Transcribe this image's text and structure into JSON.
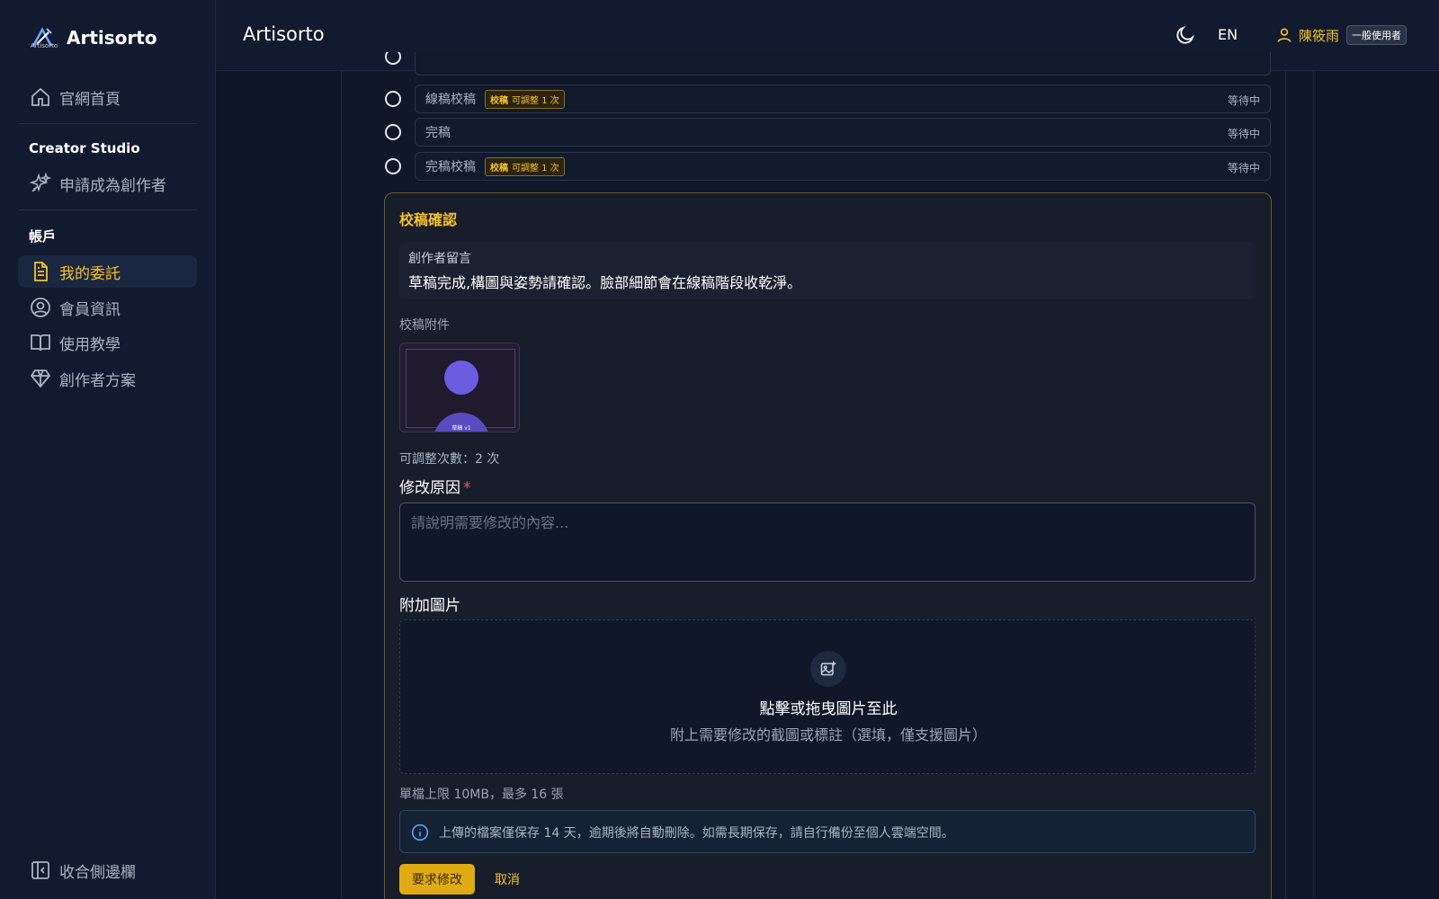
{
  "brand": {
    "name": "Artisorto",
    "sub": "Artisorto"
  },
  "sidebar": {
    "home": "官網首頁",
    "creator_section": "Creator Studio",
    "apply_creator": "申請成為創作者",
    "account_section": "帳戶",
    "items": [
      "我的委託",
      "會員資訊",
      "使用教學",
      "創作者方案"
    ],
    "collapse": "收合側邊欄"
  },
  "header": {
    "title": "Artisorto",
    "lang": "EN",
    "user_name": "陳筱雨",
    "user_role": "一般使用者"
  },
  "steps": [
    {
      "name": "線稿校稿",
      "tag_label": "校稿",
      "tag_text": "可調整 1 次",
      "status": "等待中"
    },
    {
      "name": "完稿",
      "status": "等待中"
    },
    {
      "name": "完稿校稿",
      "tag_label": "校稿",
      "tag_text": "可調整 1 次",
      "status": "等待中"
    }
  ],
  "panel": {
    "title": "校稿確認",
    "message_label": "創作者留言",
    "message_text": "草稿完成,構圖與姿勢請確認。臉部細節會在線稿階段收乾淨。",
    "attachment_label": "校稿附件",
    "thumb_caption": "草稿 v1",
    "adjust_count": "可調整次數：2 次",
    "reason_label": "修改原因",
    "required_mark": "*",
    "reason_placeholder": "請說明需要修改的內容...",
    "image_label": "附加圖片",
    "dropzone_title": "點擊或拖曳圖片至此",
    "dropzone_sub": "附上需要修改的截圖或標註（選填，僅支援圖片）",
    "limit_text": "單檔上限 10MB，最多 16 張",
    "notice_text": "上傳的檔案僅保存 14 天，逾期後將自動刪除。如需長期保存，請自行備份至個人雲端空間。",
    "submit_label": "要求修改",
    "cancel_label": "取消"
  },
  "colors": {
    "accent": "#f4c22b",
    "bg": "#0d1526",
    "panel_border": "#6e5a24"
  }
}
